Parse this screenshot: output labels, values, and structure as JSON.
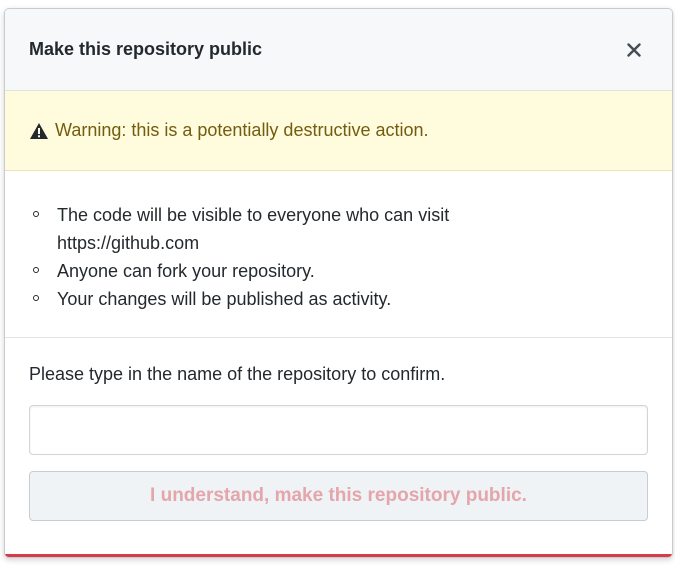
{
  "dialog": {
    "title": "Make this repository public",
    "close_icon": "close-icon"
  },
  "warning": {
    "icon": "alert-triangle-icon",
    "text": "Warning: this is a potentially destructive action."
  },
  "consequences": [
    {
      "line1": "The code will be visible to everyone who can visit",
      "line2": "https://github.com"
    },
    {
      "line1": "Anyone can fork your repository.",
      "line2": ""
    },
    {
      "line1": "Your changes will be published as activity.",
      "line2": ""
    }
  ],
  "confirm": {
    "label": "Please type in the name of the repository to confirm.",
    "input_value": "",
    "input_placeholder": "",
    "button_label": "I understand, make this repository public.",
    "button_disabled": true
  },
  "colors": {
    "warning_bg": "#fffbdd",
    "warning_text": "#735c0f",
    "danger_text_disabled": "#e4a6aa",
    "danger_accent": "#d73a49"
  }
}
